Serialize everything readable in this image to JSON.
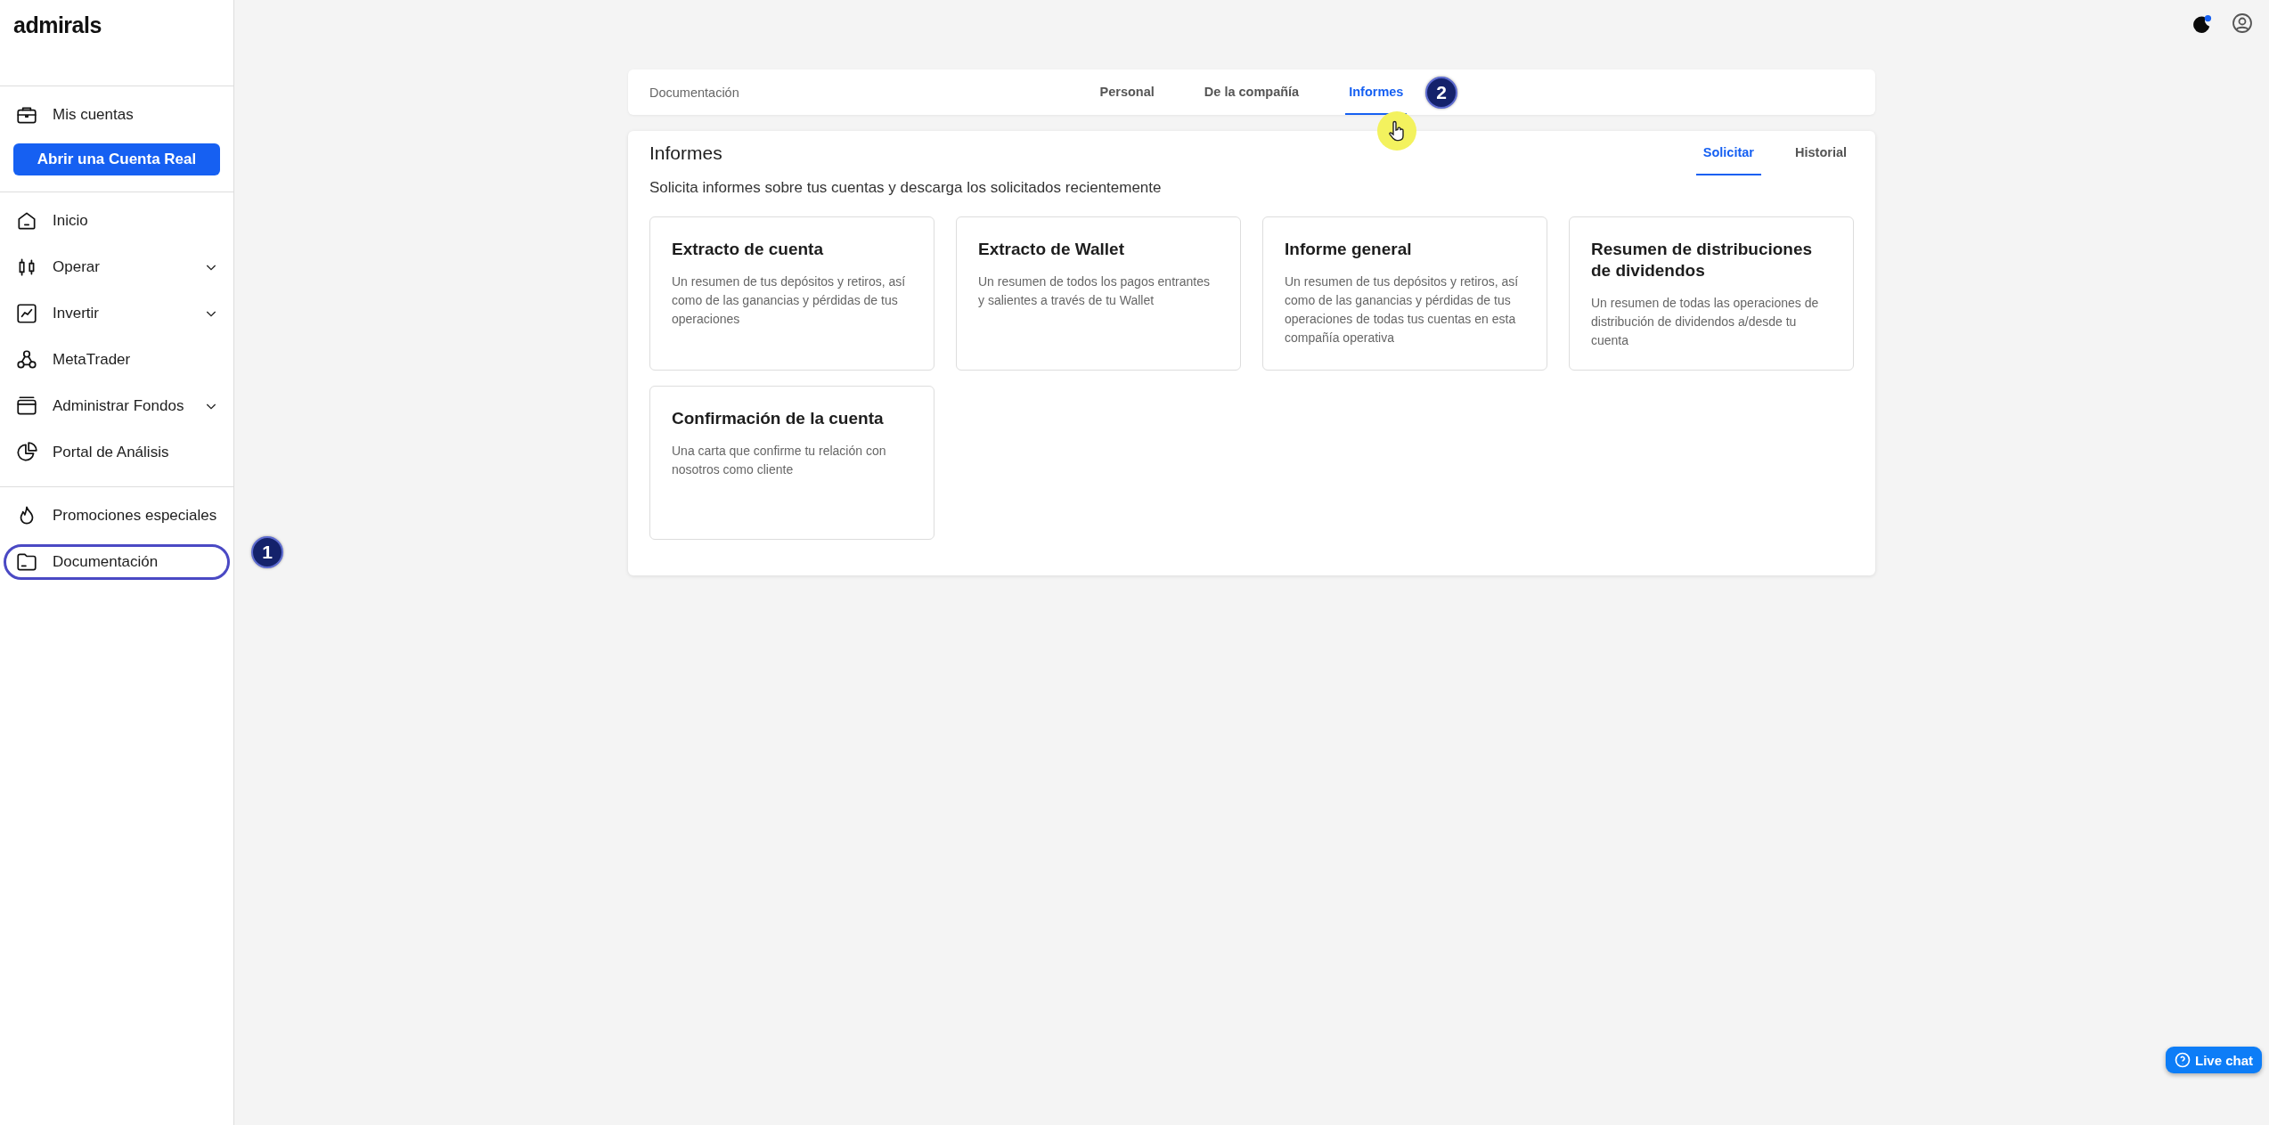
{
  "sidebar": {
    "logo": "admirals",
    "sections": [
      {
        "items": [
          {
            "kind": "link",
            "label": "Mis cuentas",
            "expandable": false,
            "highlighted": false
          },
          {
            "kind": "button",
            "label": "Abrir una Cuenta Real"
          }
        ]
      },
      {
        "items": [
          {
            "kind": "link",
            "label": "Inicio",
            "expandable": false,
            "highlighted": false
          },
          {
            "kind": "link",
            "label": "Operar",
            "expandable": true,
            "highlighted": false
          },
          {
            "kind": "link",
            "label": "Invertir",
            "expandable": true,
            "highlighted": false
          },
          {
            "kind": "link",
            "label": "MetaTrader",
            "expandable": false,
            "highlighted": false
          },
          {
            "kind": "link",
            "label": "Administrar Fondos",
            "expandable": true,
            "highlighted": false
          },
          {
            "kind": "link",
            "label": "Portal de Análisis",
            "expandable": false,
            "highlighted": false
          }
        ]
      },
      {
        "items": [
          {
            "kind": "link",
            "label": "Promociones especiales",
            "expandable": false,
            "highlighted": false
          },
          {
            "kind": "link",
            "label": "Documentación",
            "expandable": false,
            "highlighted": true
          }
        ]
      }
    ]
  },
  "tabs": {
    "section_label": "Documentación",
    "items": [
      {
        "label": "Personal",
        "selected": false
      },
      {
        "label": "De la compañía",
        "selected": false
      },
      {
        "label": "Informes",
        "selected": true
      }
    ]
  },
  "reports": {
    "title": "Informes",
    "subtitle": "Solicita informes sobre tus cuentas y descarga los solicitados recientemente",
    "subtabs": [
      {
        "label": "Solicitar",
        "selected": true
      },
      {
        "label": "Historial",
        "selected": false
      }
    ],
    "cards": [
      {
        "title": "Extracto de cuenta",
        "description": "Un resumen de tus depósitos y retiros, así como de las ganancias y pérdidas de tus operaciones"
      },
      {
        "title": "Extracto de Wallet",
        "description": "Un resumen de todos los pagos entrantes y salientes a través de tu Wallet"
      },
      {
        "title": "Informe general",
        "description": "Un resumen de tus depósitos y retiros, así como de las ganancias y pérdidas de tus operaciones de todas tus cuentas en esta compañía operativa"
      },
      {
        "title": "Resumen de distribuciones de dividendos",
        "description": "Un resumen de todas las operaciones de distribución de dividendos a/desde tu cuenta"
      },
      {
        "title": "Confirmación de la cuenta",
        "description": "Una carta que confirme tu relación con nosotros como cliente"
      }
    ]
  },
  "annotations": [
    "1",
    "2"
  ],
  "live_chat": "Live chat"
}
